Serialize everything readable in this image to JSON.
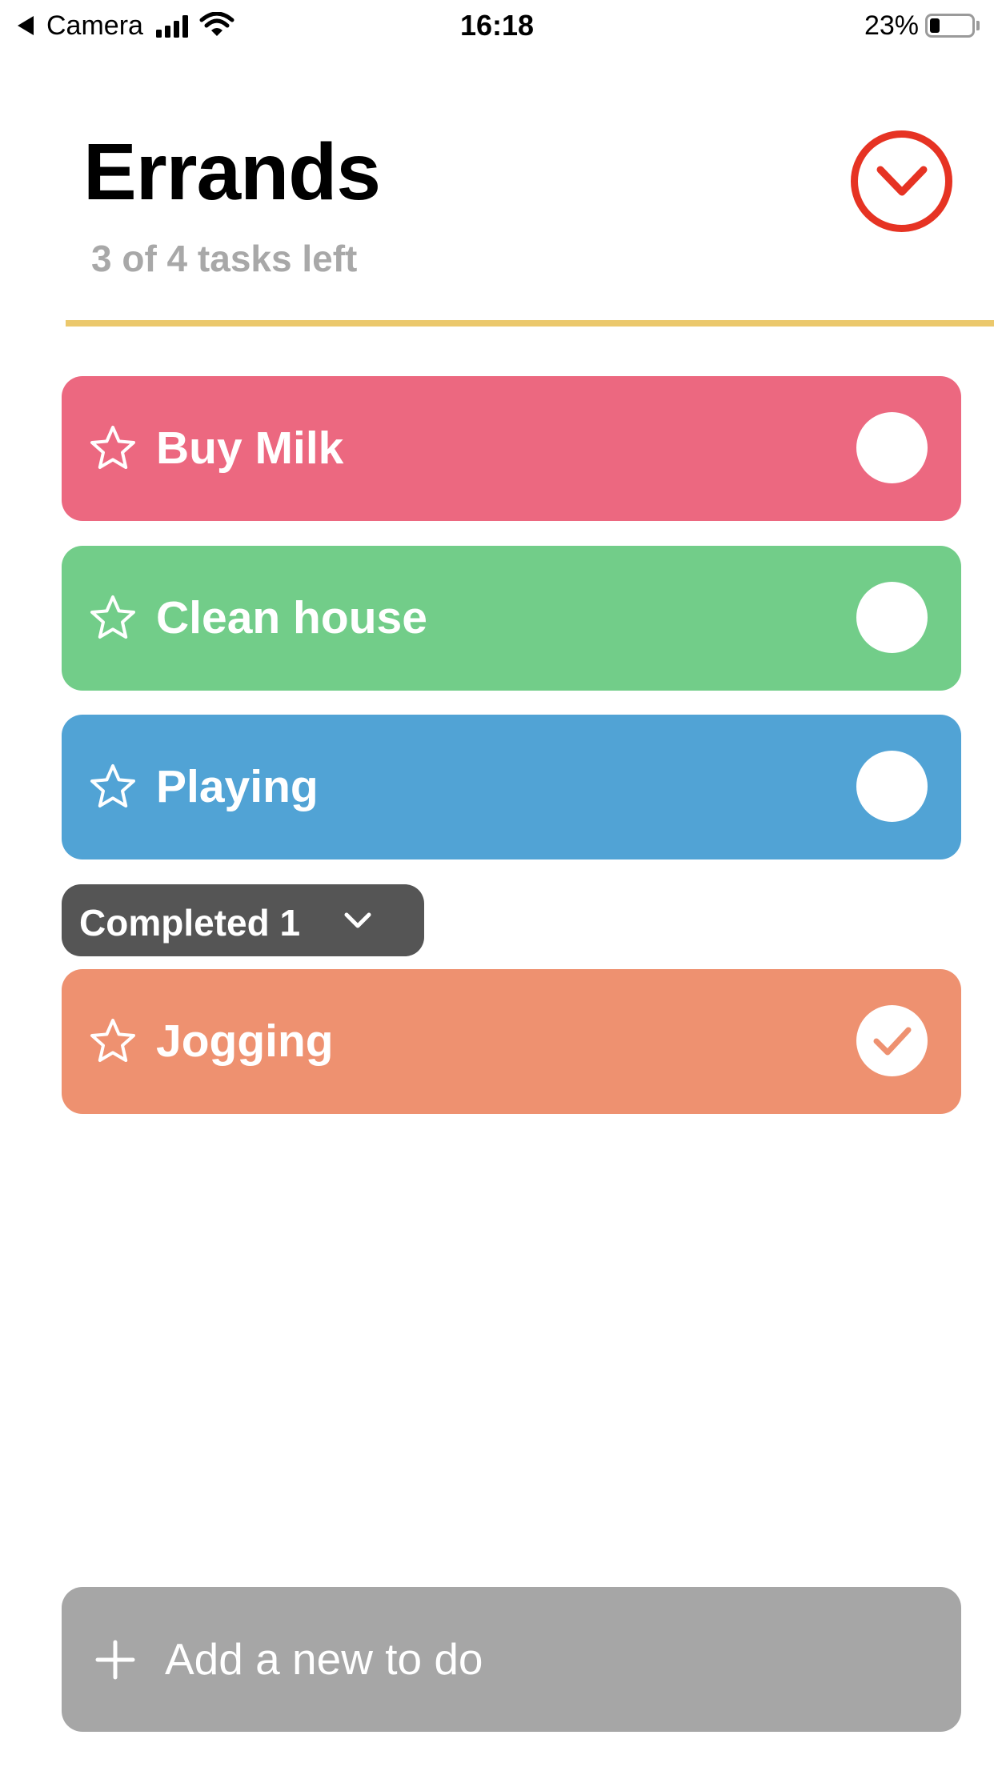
{
  "status_bar": {
    "back_app": "Camera",
    "time": "16:18",
    "battery": "23%",
    "battery_level": 0.23
  },
  "header": {
    "title": "Errands",
    "subtitle": "3 of 4 tasks left",
    "accent_color": "#e63323",
    "divider_color": "#ebc86c",
    "toggle_icon": "chevron-down-circle-icon"
  },
  "tasks": [
    {
      "label": "Buy Milk",
      "color": "#ec6880",
      "completed": false,
      "starred": false
    },
    {
      "label": "Clean house",
      "color": "#72cd89",
      "completed": false,
      "starred": false
    },
    {
      "label": "Playing",
      "color": "#51a3d5",
      "completed": false,
      "starred": false
    }
  ],
  "completed_section": {
    "label": "Completed 1",
    "color": "#555555",
    "tasks": [
      {
        "label": "Jogging",
        "color": "#ee9170",
        "completed": true,
        "starred": false
      }
    ]
  },
  "add_bar": {
    "label": "Add a new to do",
    "color": "#a6a6a6"
  }
}
